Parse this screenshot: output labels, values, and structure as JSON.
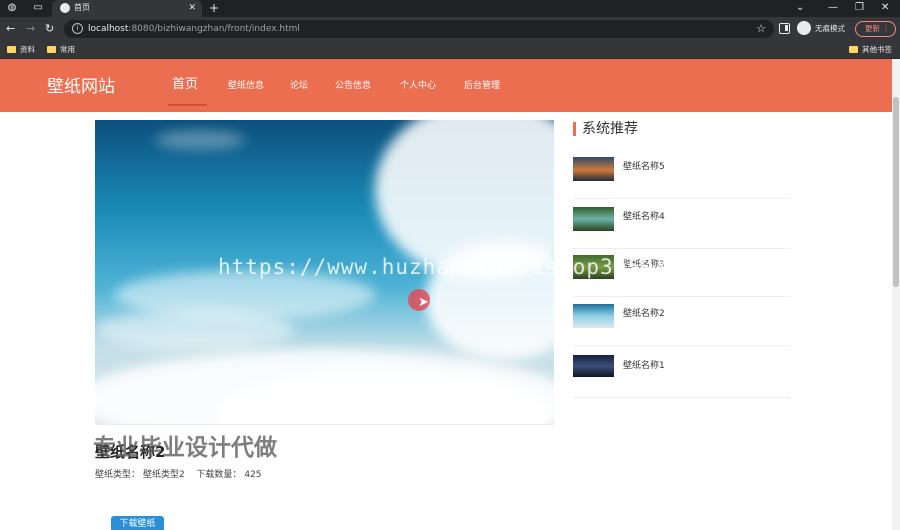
{
  "browser": {
    "tab_title": "首页",
    "address_host": "localhost",
    "address_path": ":8080/bizhiwangzhan/front/index.html",
    "incognito_label": "无痕模式",
    "update_label": "更新",
    "bookmarks": [
      "资料",
      "常用"
    ],
    "other_bookmarks": "其他书签"
  },
  "site": {
    "logo": "壁纸网站",
    "nav": [
      {
        "label": "首页",
        "active": true
      },
      {
        "label": "壁纸信息",
        "active": false
      },
      {
        "label": "论坛",
        "active": false
      },
      {
        "label": "公告信息",
        "active": false
      },
      {
        "label": "个人中心",
        "active": false
      },
      {
        "label": "后台管理",
        "active": false
      }
    ]
  },
  "detail": {
    "title": "壁纸名称2",
    "type_label": "壁纸类型：",
    "type_value": "壁纸类型2",
    "count_label": "下载数量：",
    "count_value": "425",
    "download_button": "下载壁纸"
  },
  "recommend": {
    "title": "系统推荐",
    "items": [
      {
        "name": "壁纸名称5"
      },
      {
        "name": "壁纸名称4"
      },
      {
        "name": "壁纸名称3"
      },
      {
        "name": "壁纸名称2"
      },
      {
        "name": "壁纸名称1"
      }
    ]
  },
  "overlay": {
    "watermark_url": "https://www.huzhan.com/ishop39597",
    "watermark_text": "专业毕业设计代做"
  },
  "colors": {
    "header": "#ec6e51",
    "accent_bar": "#ec6e51",
    "download_button": "#2a8fd6"
  }
}
